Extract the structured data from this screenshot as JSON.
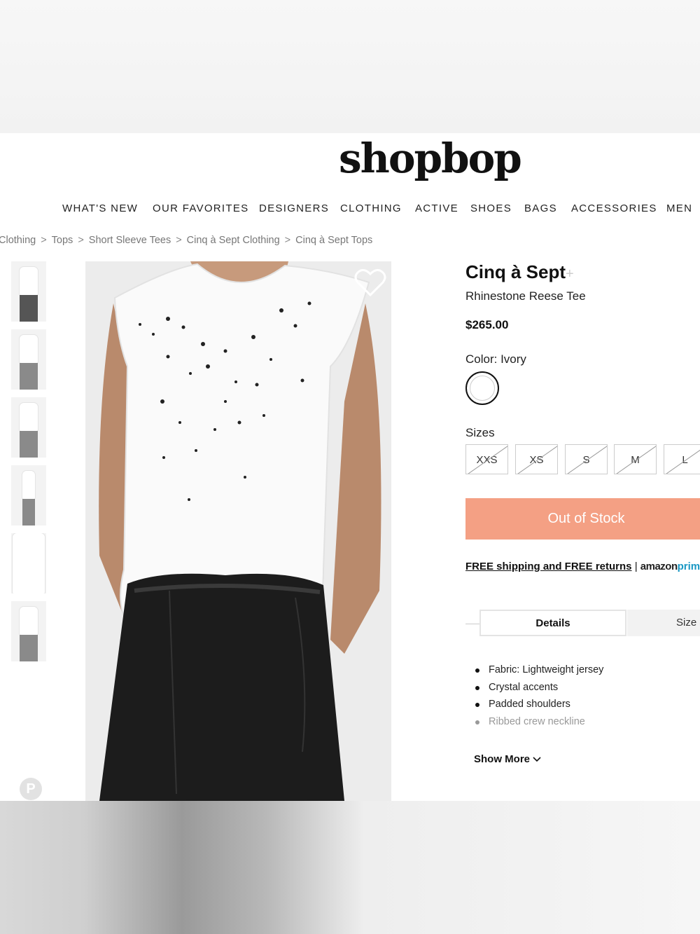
{
  "header": {
    "logo": "shopbop"
  },
  "nav": {
    "items": [
      "WHAT'S NEW",
      "OUR FAVORITES",
      "DESIGNERS",
      "CLOTHING",
      "ACTIVE",
      "SHOES",
      "BAGS",
      "ACCESSORIES",
      "MEN"
    ]
  },
  "breadcrumb": {
    "items": [
      "Clothing",
      "Tops",
      "Short Sleeve Tees",
      "Cinq à Sept Clothing",
      "Cinq à Sept Tops"
    ],
    "separator": ">"
  },
  "product": {
    "brand": "Cinq à Sept",
    "brand_plus": "+",
    "name": "Rhinestone Reese Tee",
    "price": "$265.00",
    "color_label": "Color: Ivory",
    "sizes_label": "Sizes",
    "sizes": [
      "XXS",
      "XS",
      "S",
      "M",
      "L"
    ],
    "stock_button": "Out of Stock",
    "shipping_free": "FREE shipping and FREE returns",
    "shipping_sep": "|",
    "shipping_amazon": "amazon",
    "shipping_prime": "prime",
    "shipping_tail": "e"
  },
  "tabs": {
    "details": "Details",
    "size": "Size &"
  },
  "details": {
    "bullets": [
      "Fabric: Lightweight jersey",
      "Crystal accents",
      "Padded shoulders",
      "Ribbed crew neckline"
    ],
    "show_more": "Show More"
  },
  "icons": {
    "heart": "heart-outline-icon",
    "pinterest": "pinterest-icon",
    "chevron": "chevron-down-icon"
  },
  "colors": {
    "out_of_stock": "#f4a084",
    "prime": "#1a98c4"
  }
}
